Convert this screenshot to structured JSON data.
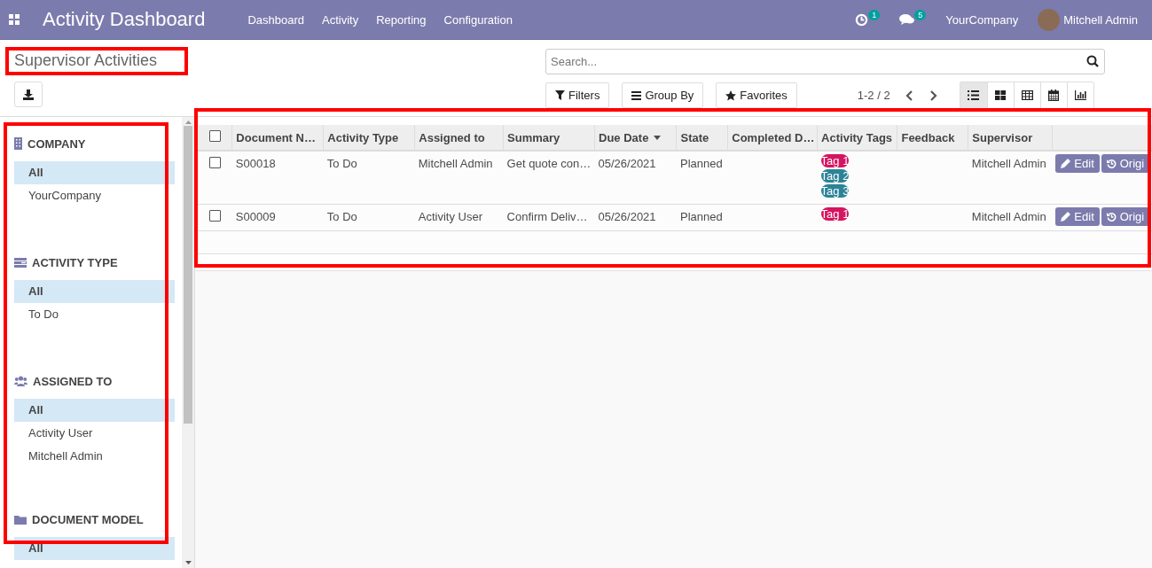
{
  "navbar": {
    "title": "Activity Dashboard",
    "menu": [
      "Dashboard",
      "Activity",
      "Reporting",
      "Configuration"
    ],
    "activity_count": "1",
    "message_count": "5",
    "company": "YourCompany",
    "user": "Mitchell Admin"
  },
  "control_panel": {
    "breadcrumb": "Supervisor Activities",
    "search": {
      "placeholder": "Search..."
    },
    "filters": [
      "Filters",
      "Group By",
      "Favorites"
    ],
    "pager": "1-2 / 2",
    "views": [
      {
        "kind": "list",
        "selected": true
      },
      {
        "kind": "kanban",
        "selected": false
      },
      {
        "kind": "pivot",
        "selected": false
      },
      {
        "kind": "calendar",
        "selected": false
      },
      {
        "kind": "graph",
        "selected": false
      }
    ]
  },
  "sidebar": {
    "sections": [
      {
        "kind": "company",
        "title": "COMPANY",
        "items": [
          {
            "label": "All",
            "selected": true
          },
          {
            "label": "YourCompany",
            "selected": false
          }
        ]
      },
      {
        "kind": "type",
        "title": "ACTIVITY TYPE",
        "items": [
          {
            "label": "All",
            "selected": true
          },
          {
            "label": "To Do",
            "selected": false
          }
        ]
      },
      {
        "kind": "users",
        "title": "ASSIGNED TO",
        "items": [
          {
            "label": "All",
            "selected": true
          },
          {
            "label": "Activity User",
            "selected": false
          },
          {
            "label": "Mitchell Admin",
            "selected": false
          }
        ]
      },
      {
        "kind": "model",
        "title": "DOCUMENT MODEL",
        "items": [
          {
            "label": "All",
            "selected": true
          }
        ]
      }
    ]
  },
  "table": {
    "checked": false,
    "columns": [
      "Document N…",
      "Activity Type",
      "Assigned to",
      "Summary",
      "Due Date",
      "State",
      "Completed D…",
      "Activity Tags",
      "Feedback",
      "Supervisor"
    ],
    "rows": [
      {
        "checked": false,
        "cells": [
          "S00018",
          "To Do",
          "Mitchell Admin",
          "Get quote con…",
          "05/26/2021",
          "Planned",
          ""
        ],
        "tags": [
          {
            "label": "Tag 1",
            "color": "#d6145f"
          },
          {
            "label": "Tag 2",
            "color": "#2c8397"
          },
          {
            "label": "Tag 3",
            "color": "#2c8397"
          }
        ],
        "feedback": "",
        "supervisor": "Mitchell Admin",
        "buttons": [
          "Edit",
          "Origi"
        ]
      },
      {
        "checked": false,
        "cells": [
          "S00009",
          "To Do",
          "Activity User",
          "Confirm Deliv…",
          "05/26/2021",
          "Planned",
          ""
        ],
        "tags": [
          {
            "label": "Tag 1",
            "color": "#d6145f"
          }
        ],
        "feedback": "",
        "supervisor": "Mitchell Admin",
        "buttons": [
          "Edit",
          "Origi"
        ]
      }
    ]
  }
}
